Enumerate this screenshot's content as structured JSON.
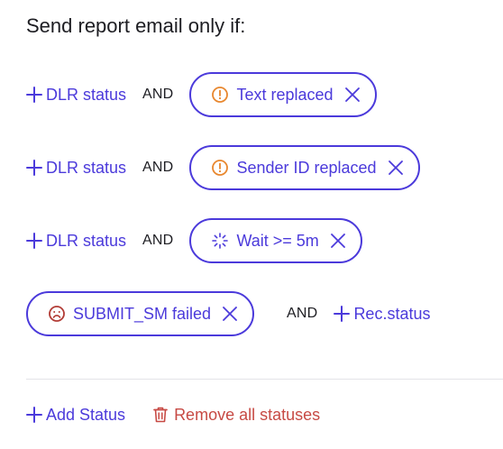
{
  "title": "Send report email only if:",
  "rows": [
    {
      "add_label": "DLR status",
      "and_label": "AND",
      "chip_label": "Text replaced",
      "chip_icon": "alert-circle-icon"
    },
    {
      "add_label": "DLR status",
      "and_label": "AND",
      "chip_label": "Sender ID replaced",
      "chip_icon": "alert-circle-icon"
    },
    {
      "add_label": "DLR status",
      "and_label": "AND",
      "chip_label": "Wait >= 5m",
      "chip_icon": "spinner-icon"
    }
  ],
  "row4": {
    "chip_label": "SUBMIT_SM failed",
    "chip_icon": "sad-face-icon",
    "and_label": "AND",
    "add_label": "Rec.status"
  },
  "footer": {
    "add_label": "Add Status",
    "remove_label": "Remove all statuses"
  },
  "colors": {
    "accent": "#4b3adb",
    "warning": "#e8872e",
    "danger": "#c74a44",
    "error_icon": "#b23c36"
  }
}
